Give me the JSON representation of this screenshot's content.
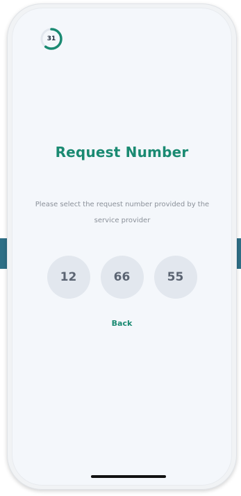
{
  "timer": {
    "value": "31",
    "progress": 0.6,
    "icon": "countdown-ring-icon",
    "color": "#1a8a72"
  },
  "title": "Request Number",
  "subtitle": "Please select the request number provided by the service provider",
  "options": [
    "12",
    "66",
    "55"
  ],
  "back_label": "Back",
  "colors": {
    "accent": "#1a8a72",
    "choice_bg": "#e2e7ee",
    "choice_text": "#5b6472",
    "side_tab": "#2e6f86"
  }
}
